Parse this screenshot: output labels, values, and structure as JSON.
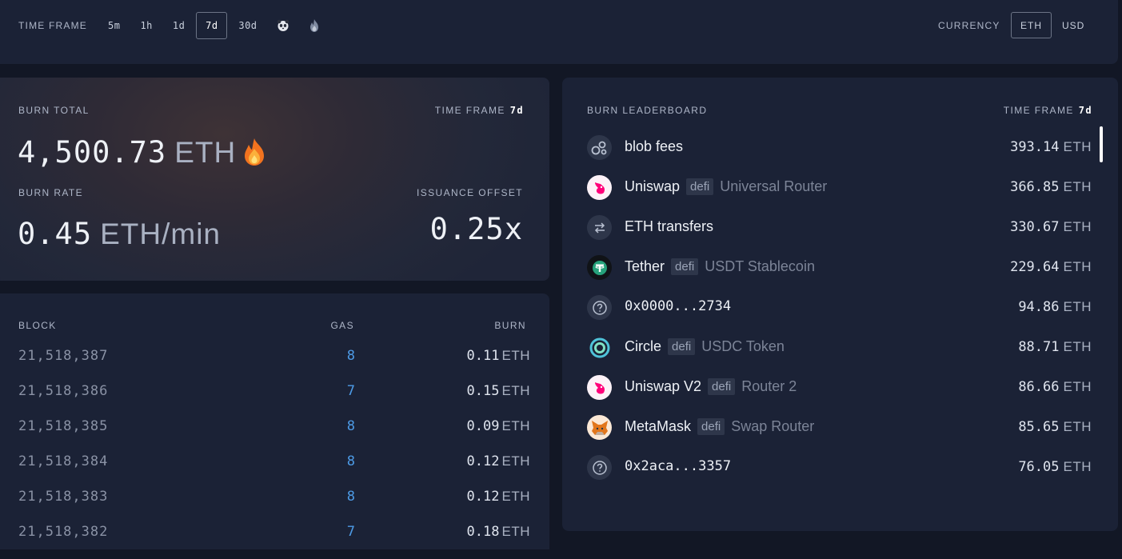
{
  "header": {
    "timeframe_label": "TIME FRAME",
    "timeframe_options": [
      "5m",
      "1h",
      "1d",
      "7d",
      "30d"
    ],
    "timeframe_selected": "7d",
    "timeframe_icon_options": [
      "panda-icon",
      "fire-icon"
    ],
    "currency_label": "CURRENCY",
    "currency_options": [
      "ETH",
      "USD"
    ],
    "currency_selected": "ETH"
  },
  "burn_total": {
    "label": "BURN TOTAL",
    "timeframe_label": "TIME FRAME",
    "timeframe_value": "7d",
    "value": "4,500.73",
    "unit": "ETH",
    "icon": "fire-icon",
    "rate_label": "BURN RATE",
    "rate_value": "0.45",
    "rate_unit": "ETH/min",
    "offset_label": "ISSUANCE OFFSET",
    "offset_value": "0.25x"
  },
  "blocks": {
    "headers": {
      "block": "BLOCK",
      "gas": "GAS",
      "burn": "BURN"
    },
    "unit": "ETH",
    "rows": [
      {
        "block": "21,518,387",
        "gas": "8",
        "burn": "0.11"
      },
      {
        "block": "21,518,386",
        "gas": "7",
        "burn": "0.15"
      },
      {
        "block": "21,518,385",
        "gas": "8",
        "burn": "0.09"
      },
      {
        "block": "21,518,384",
        "gas": "8",
        "burn": "0.12"
      },
      {
        "block": "21,518,383",
        "gas": "8",
        "burn": "0.12"
      },
      {
        "block": "21,518,382",
        "gas": "7",
        "burn": "0.18"
      }
    ]
  },
  "leaderboard": {
    "label": "BURN LEADERBOARD",
    "timeframe_label": "TIME FRAME",
    "timeframe_value": "7d",
    "unit": "ETH",
    "rows": [
      {
        "icon": "blob-icon",
        "name": "blob fees",
        "tag": "",
        "sub": "",
        "value": "393.14"
      },
      {
        "icon": "uniswap-icon",
        "name": "Uniswap",
        "tag": "defi",
        "sub": "Universal Router",
        "value": "366.85"
      },
      {
        "icon": "transfer-icon",
        "name": "ETH transfers",
        "tag": "",
        "sub": "",
        "value": "330.67"
      },
      {
        "icon": "tether-icon",
        "name": "Tether",
        "tag": "defi",
        "sub": "USDT Stablecoin",
        "value": "229.64"
      },
      {
        "icon": "question-icon",
        "name": "0x0000...2734",
        "tag": "",
        "sub": "",
        "value": "94.86"
      },
      {
        "icon": "circle-icon",
        "name": "Circle",
        "tag": "defi",
        "sub": "USDC Token",
        "value": "88.71"
      },
      {
        "icon": "uniswap-icon",
        "name": "Uniswap V2",
        "tag": "defi",
        "sub": "Router 2",
        "value": "86.66"
      },
      {
        "icon": "metamask-icon",
        "name": "MetaMask",
        "tag": "defi",
        "sub": "Swap Router",
        "value": "85.65"
      },
      {
        "icon": "question-icon",
        "name": "0x2aca...3357",
        "tag": "",
        "sub": "",
        "value": "76.05"
      }
    ]
  }
}
